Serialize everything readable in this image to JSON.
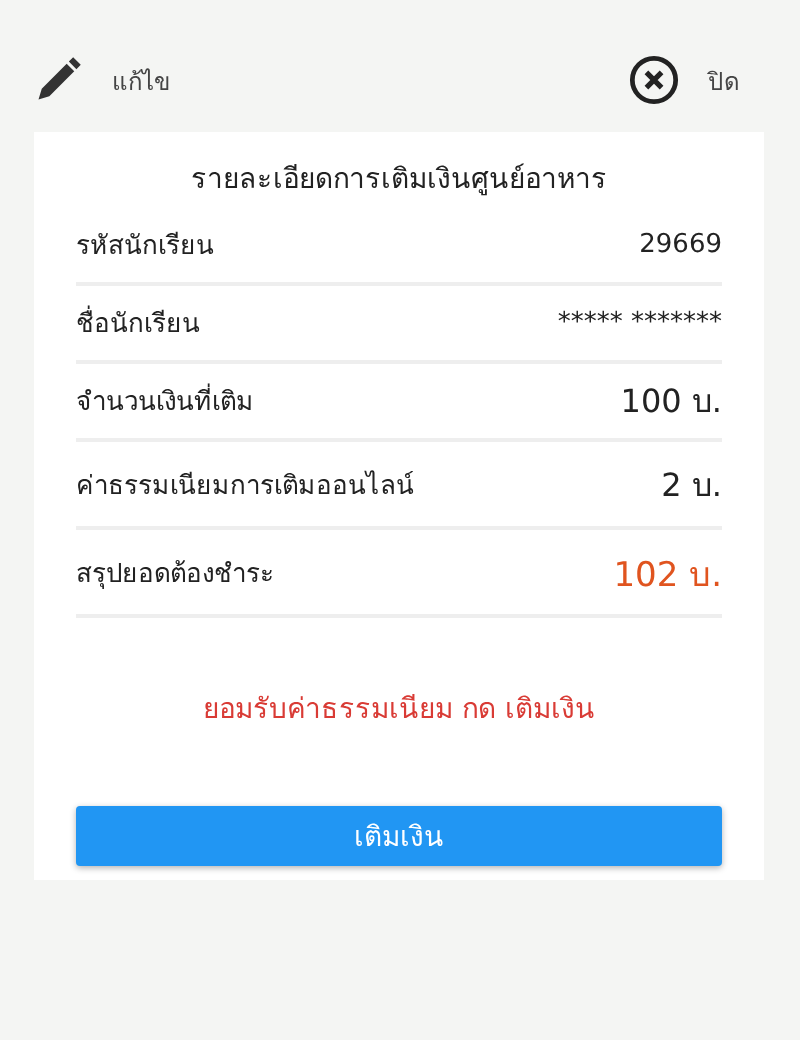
{
  "header": {
    "edit_label": "แก้ไข",
    "close_label": "ปิด"
  },
  "card": {
    "title": "รายละเอียดการเติมเงินศูนย์อาหาร",
    "rows": [
      {
        "label": "รหัสนักเรียน",
        "value": "29669",
        "kind": "plain"
      },
      {
        "label": "ชื่อนักเรียน",
        "value": "***** *******",
        "kind": "plain"
      },
      {
        "label": "จำนวนเงินที่เติม",
        "value": "100 บ.",
        "kind": "amount"
      },
      {
        "label": "ค่าธรรมเนียมการเติมออนไลน์",
        "value": "2 บ.",
        "kind": "amount"
      },
      {
        "label": "สรุปยอดต้องชำระ",
        "value": "102 บ.",
        "kind": "total"
      }
    ],
    "notice": "ยอมรับค่าธรรมเนียม กด เติมเงิน",
    "button": "เติมเงิน"
  }
}
